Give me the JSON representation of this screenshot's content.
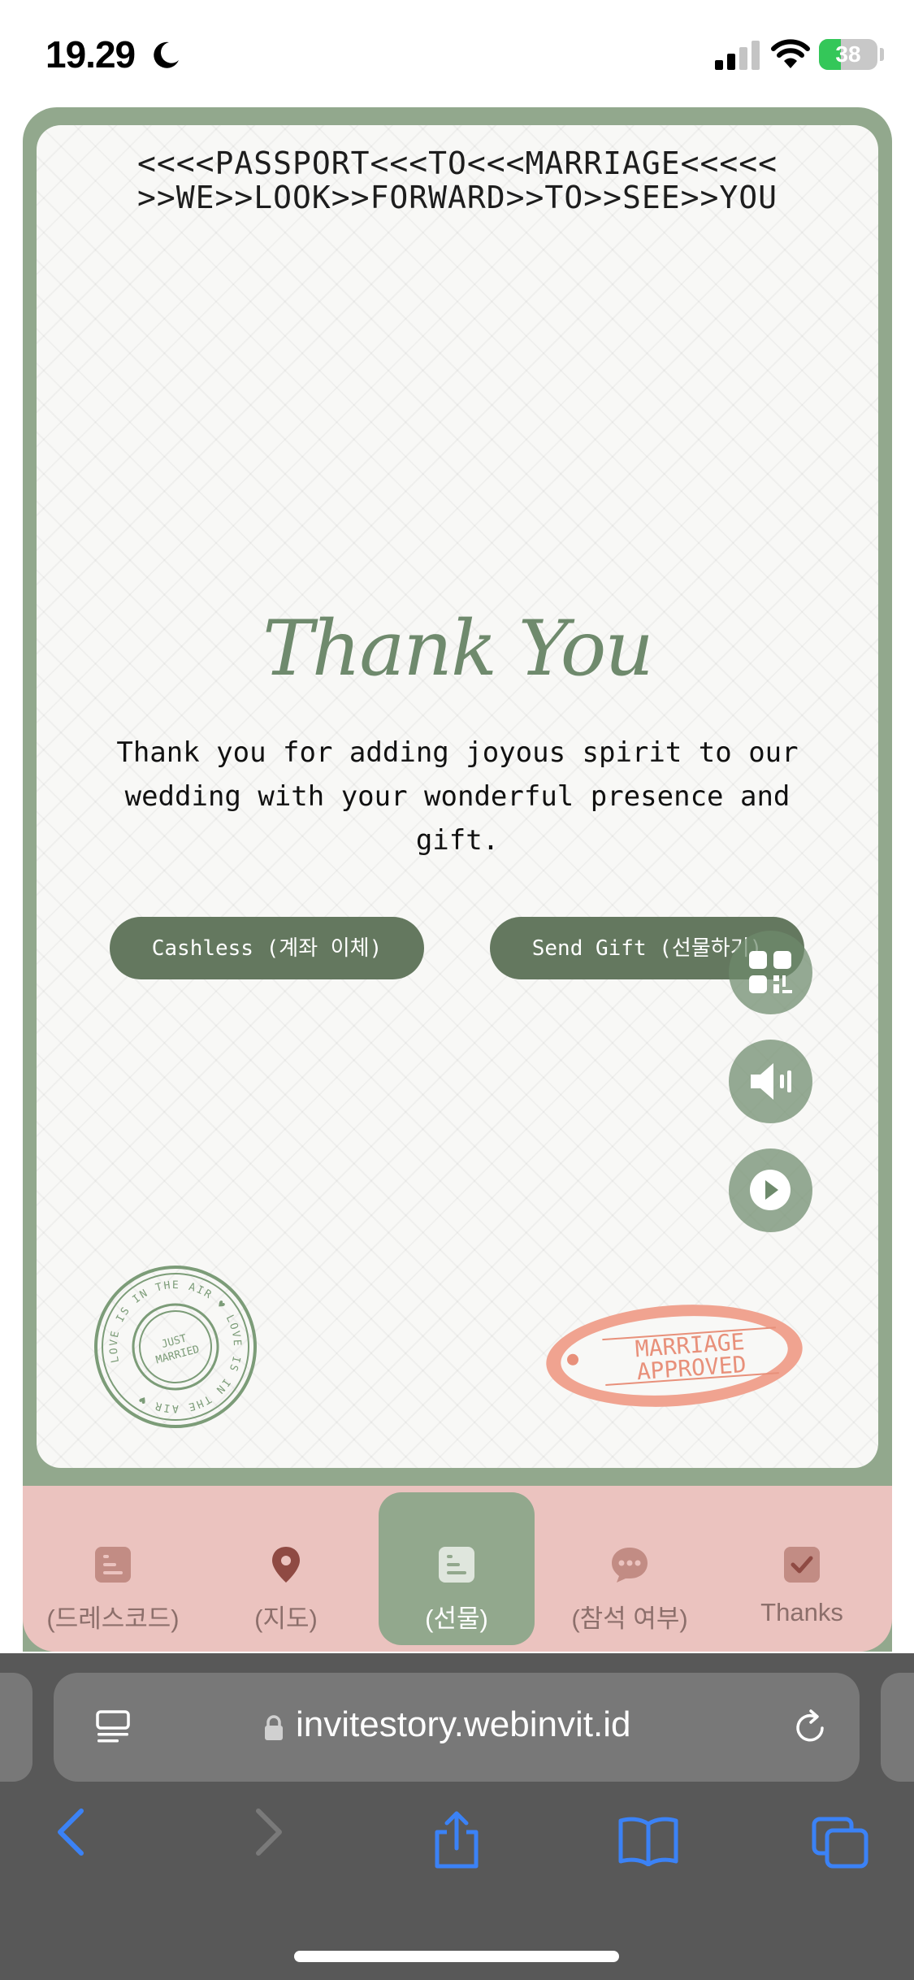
{
  "status_bar": {
    "time": "19.29",
    "battery_level": "38"
  },
  "card": {
    "mrz_line_1": "<<<<PASSPORT<<<TO<<<MARRIAGE<<<<<",
    "mrz_line_2": ">>WE>>LOOK>>FORWARD>>TO>>SEE>>YOU",
    "title": "Thank You",
    "message": "Thank you for adding joyous spirit to our wedding with your wonderful presence and gift.",
    "buttons": {
      "cashless": "Cashless (계좌 이체)",
      "send_gift": "Send Gift (선물하기)"
    },
    "stamps": {
      "love_ring_text": "LOVE IS IN THE AIR ♥ LOVE IS IN THE AIR ♥",
      "love_center_line_1": "JUST",
      "love_center_line_2": "MARRIED",
      "approved_line_1": "MARRIAGE",
      "approved_line_2": "APPROVED"
    }
  },
  "nav": {
    "items": [
      {
        "label": "(드레스코드)",
        "icon": "document-icon"
      },
      {
        "label": "(지도)",
        "icon": "map-pin-icon"
      },
      {
        "label": "(선물)",
        "icon": "gift-document-icon",
        "active": true
      },
      {
        "label": "(참석 여부)",
        "icon": "chat-bubble-icon"
      },
      {
        "label": "Thanks",
        "icon": "check-square-icon"
      }
    ]
  },
  "browser": {
    "url": "invitestory.webinvit.id"
  },
  "colors": {
    "frame_green": "#92a88d",
    "button_green": "#64785f",
    "nav_pink": "#ebc3bf",
    "stamp_salmon": "#e8907a",
    "ios_blue": "#3b82f6"
  }
}
